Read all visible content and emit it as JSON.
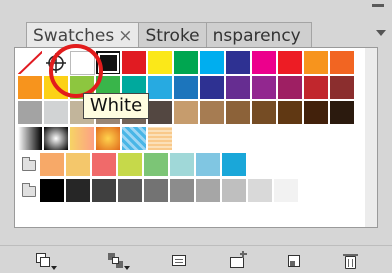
{
  "panel": {
    "tabs": [
      {
        "label": "Swatches",
        "close": "×"
      },
      {
        "label": "Stroke"
      },
      {
        "label": "nsparency"
      }
    ]
  },
  "tooltip": {
    "text": "White"
  },
  "swatch_rows": {
    "row1": [
      "#ffffff",
      "#ffffff",
      "#ffffff",
      "#111111",
      "#e11b22",
      "#fbe819",
      "#00a650",
      "#00aeef",
      "#2e3192",
      "#ec008c",
      "#ed1c24",
      "#f7941d",
      "#f26522"
    ],
    "row2": [
      "#f7941d",
      "#fcd116",
      "#8dc63f",
      "#39b54a",
      "#00a99d",
      "#27aae1",
      "#1c75bc",
      "#2e3192",
      "#662d91",
      "#92278f",
      "#9e1f63",
      "#c1272d",
      "#8b2e2e"
    ],
    "row3": [
      "#a3a3a3",
      "#d1d3d4",
      "#c2b59b",
      "#998675",
      "#736357",
      "#534741",
      "#c69c6d",
      "#a67c52",
      "#8c6239",
      "#754c24",
      "#603813",
      "#42210b",
      "#2b1a0e"
    ],
    "row4": [
      "#000000",
      "#888888",
      "#f7d26a",
      "#9bd0e8",
      "#f5c38a"
    ],
    "row5_colors": [
      "#f7a968",
      "#f4c76b",
      "#f06a6a",
      "#c6d94a",
      "#7cc576",
      "#a0d8d8",
      "#80c6e2",
      "#1aa7d9"
    ],
    "row6_grays": [
      "#000000",
      "#262626",
      "#404040",
      "#595959",
      "#737373",
      "#8c8c8c",
      "#a6a6a6",
      "#bfbfbf",
      "#d9d9d9",
      "#f2f2f2"
    ]
  },
  "toolbar": {
    "icons": [
      "swatch-libraries-menu-icon",
      "show-swatch-kinds-icon",
      "swatch-options-icon",
      "new-color-group-icon",
      "new-swatch-icon",
      "delete-swatch-icon"
    ]
  }
}
